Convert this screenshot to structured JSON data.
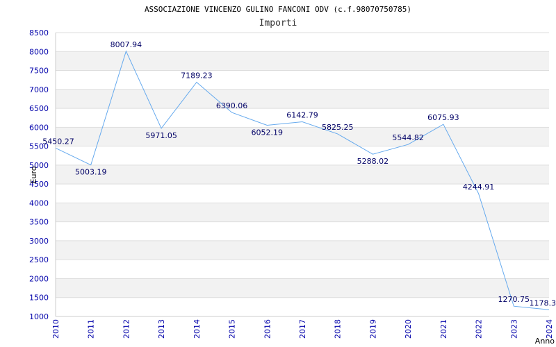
{
  "chart_data": {
    "type": "line",
    "title": "ASSOCIAZIONE VINCENZO GULINO FANCONI ODV (c.f.98070750785)",
    "subtitle": "Importi",
    "xlabel": "Anno",
    "ylabel": "Euro",
    "x": [
      "2010",
      "2011",
      "2012",
      "2013",
      "2014",
      "2015",
      "2016",
      "2017",
      "2018",
      "2019",
      "2020",
      "2021",
      "2022",
      "2023",
      "2024"
    ],
    "values": [
      5450.27,
      5003.19,
      8007.94,
      5971.05,
      7189.23,
      6390.06,
      6052.19,
      6142.79,
      5825.25,
      5288.02,
      5544.82,
      6075.93,
      4244.91,
      1270.75,
      1178.3
    ],
    "value_labels": [
      "5450.27",
      "5003.19",
      "8007.94",
      "5971.05",
      "7189.23",
      "6390.06",
      "6052.19",
      "6142.79",
      "5825.25",
      "5288.02",
      "5544.82",
      "6075.93",
      "4244.91",
      "1270.75",
      "1178.3"
    ],
    "ylim": [
      1000,
      8500
    ],
    "yticks": [
      1000,
      1500,
      2000,
      2500,
      3000,
      3500,
      4000,
      4500,
      5000,
      5500,
      6000,
      6500,
      7000,
      7500,
      8000,
      8500
    ],
    "grid": true,
    "line_color": "#66aaee",
    "band_color": "#f2f2f2"
  }
}
